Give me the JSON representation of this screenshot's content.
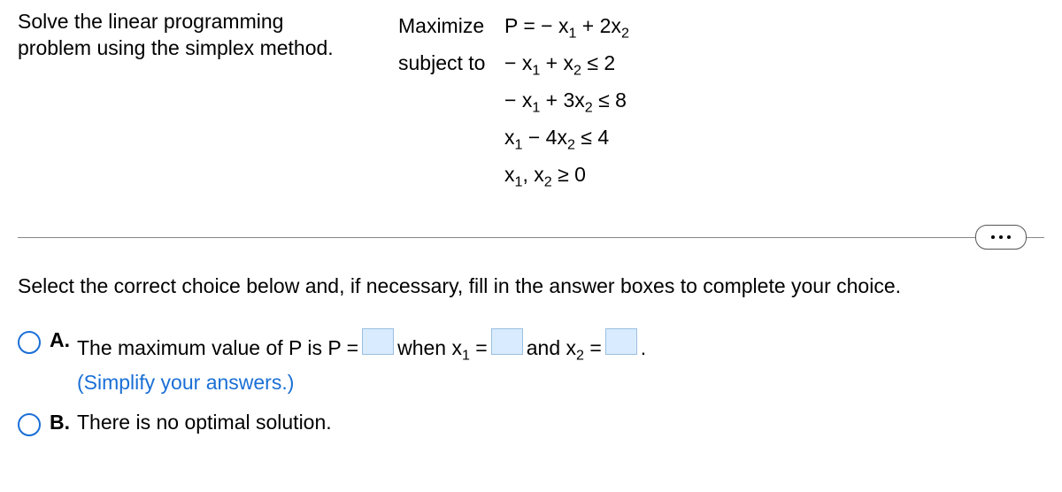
{
  "prompt": "Solve the linear programming problem using the simplex method.",
  "lp": {
    "maximize_label": "Maximize",
    "subject_label": "subject to",
    "objective_html": "P = − x<span class=\"sub\">1</span> + 2x<span class=\"sub\">2</span>",
    "constraints_html": [
      "− x<span class=\"sub\">1</span> + x<span class=\"sub\">2</span> ≤ 2",
      "− x<span class=\"sub\">1</span> + 3x<span class=\"sub\">2</span> ≤ 8",
      "x<span class=\"sub\">1</span> − 4x<span class=\"sub\">2</span> ≤ 4",
      "x<span class=\"sub\">1</span>, x<span class=\"sub\">2</span> ≥ 0"
    ]
  },
  "instruction": "Select the correct choice below and, if necessary, fill in the answer boxes to complete your choice.",
  "choices": {
    "a": {
      "label": "A.",
      "text1": "The maximum value of P is P =",
      "text2_html": "when x<span class=\"sub\">1</span> =",
      "text3_html": "and x<span class=\"sub\">2</span> =",
      "period": ".",
      "simplify": "(Simplify your answers.)"
    },
    "b": {
      "label": "B.",
      "text": "There is no optimal solution."
    }
  }
}
